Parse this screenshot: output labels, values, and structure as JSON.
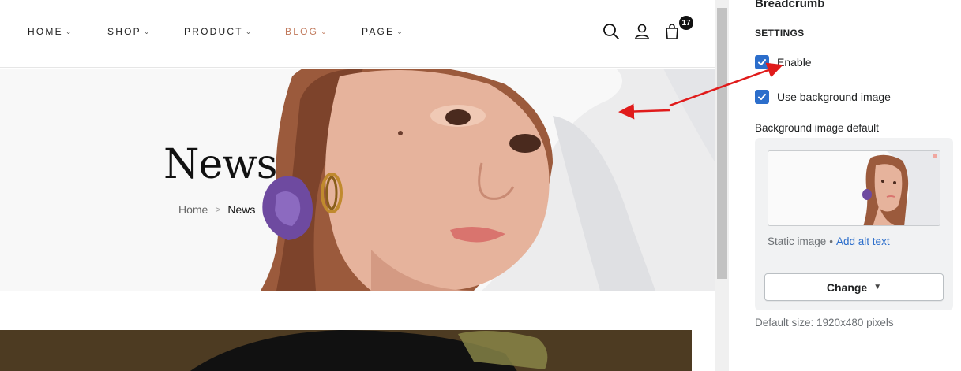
{
  "storefront": {
    "nav": [
      {
        "label": "HOME"
      },
      {
        "label": "SHOP"
      },
      {
        "label": "PRODUCT"
      },
      {
        "label": "BLOG",
        "active": true
      },
      {
        "label": "PAGE"
      }
    ],
    "cart_count": "17",
    "hero": {
      "title": "News",
      "breadcrumb": {
        "home": "Home",
        "separator": ">",
        "current": "News"
      }
    },
    "accent_color": "#c0785a"
  },
  "settings_panel": {
    "title": "Breadcrumb",
    "section_heading": "SETTINGS",
    "enable": {
      "label": "Enable",
      "checked": true
    },
    "use_background_image": {
      "label": "Use background image",
      "checked": true
    },
    "background_image": {
      "label": "Background image default",
      "image_type": "Static image",
      "separator": "•",
      "alt_link": "Add alt text",
      "change_button": "Change",
      "help": "Default size: 1920x480 pixels"
    },
    "checkbox_color": "#2c6ecb"
  },
  "icons": [
    "search-icon",
    "account-icon",
    "cart-icon",
    "chevron-down-icon",
    "checkmark-icon",
    "caret-down-icon"
  ]
}
